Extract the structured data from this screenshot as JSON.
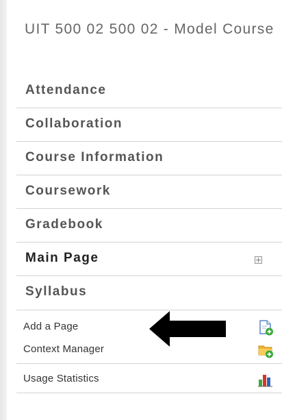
{
  "course": {
    "title": "UIT 500 02 500 02 - Model Course"
  },
  "nav": {
    "items": [
      {
        "label": "Attendance"
      },
      {
        "label": "Collaboration"
      },
      {
        "label": "Course Information"
      },
      {
        "label": "Coursework"
      },
      {
        "label": "Gradebook"
      },
      {
        "label": "Main Page",
        "current": true,
        "expand_icon": "expand-plus-icon"
      },
      {
        "label": "Syllabus"
      }
    ]
  },
  "tools": {
    "items": [
      {
        "label": "Add a Page",
        "icon": "add-page-icon"
      },
      {
        "label": "Context Manager",
        "icon": "folder-add-icon"
      },
      {
        "label": "Usage Statistics",
        "icon": "bar-chart-icon"
      }
    ]
  },
  "annotation": {
    "icon": "pointer-arrow-left-icon",
    "color": "#000000"
  },
  "colors": {
    "green_accent": "#3aa83a",
    "folder": "#f2b233",
    "chart_red": "#d8352a",
    "chart_blue": "#2f63b8"
  }
}
